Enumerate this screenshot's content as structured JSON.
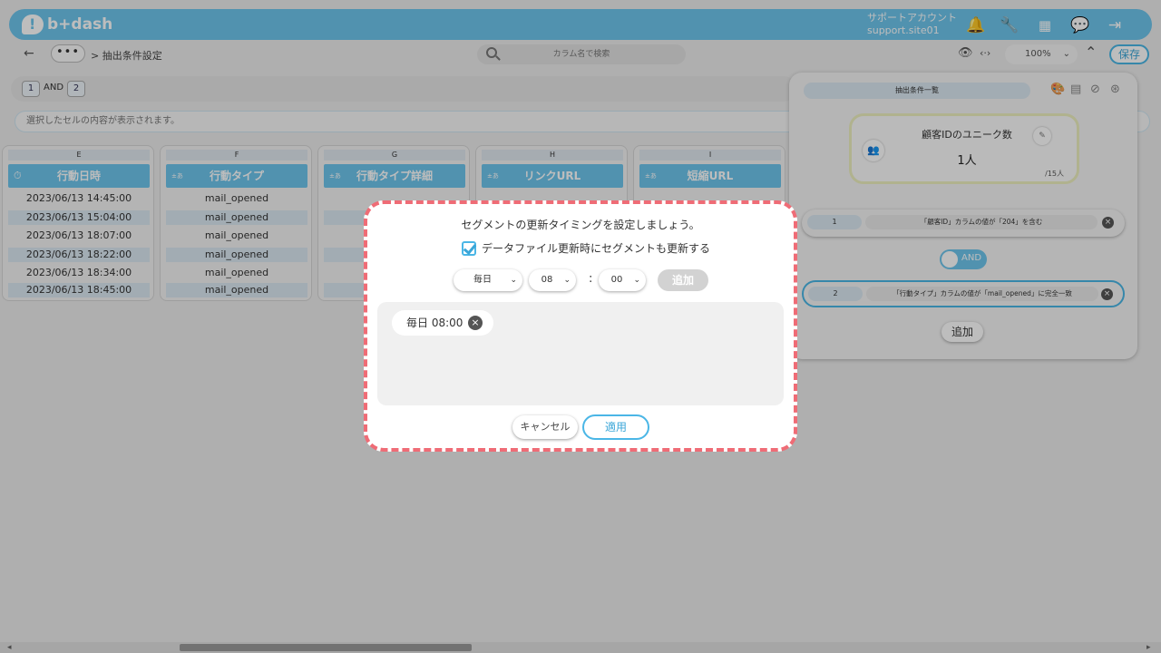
{
  "header": {
    "logo_text": "b+dash",
    "account_name": "サポートアカウント",
    "account_site": "support.site01"
  },
  "toolbar": {
    "more_label": "•••",
    "breadcrumb": "> 抽出条件設定",
    "search_placeholder": "カラム名で検索",
    "zoom_value": "100%",
    "save_label": "保存"
  },
  "conditions": {
    "tab1": "1",
    "and_label": "AND",
    "tab2": "2",
    "cell_info_placeholder": "選択したセルの内容が表示されます。"
  },
  "table": {
    "columns": [
      {
        "letter": "E",
        "type_label": "",
        "header": "行動日時",
        "cells": [
          "2023/06/13 14:45:00",
          "2023/06/13 15:04:00",
          "2023/06/13 18:07:00",
          "2023/06/13 18:22:00",
          "2023/06/13 18:34:00",
          "2023/06/13 18:45:00"
        ]
      },
      {
        "letter": "F",
        "type_label": "±あ",
        "header": "行動タイプ",
        "cells": [
          "mail_opened",
          "mail_opened",
          "mail_opened",
          "mail_opened",
          "mail_opened",
          "mail_opened"
        ]
      },
      {
        "letter": "G",
        "type_label": "±あ",
        "header": "行動タイプ詳細",
        "cells": [
          "",
          "",
          "",
          "",
          "",
          ""
        ]
      },
      {
        "letter": "H",
        "type_label": "±あ",
        "header": "リンクURL",
        "cells": [
          "",
          "",
          "",
          "",
          "",
          ""
        ]
      },
      {
        "letter": "I",
        "type_label": "±あ",
        "header": "短縮URL",
        "cells": [
          "",
          "",
          "",
          "",
          "",
          ""
        ]
      }
    ]
  },
  "right_panel": {
    "tab_label": "抽出条件一覧",
    "kpi": {
      "title": "顧客IDのユニーク数",
      "value": "1人",
      "total": "/15人"
    },
    "rules": [
      {
        "num": "1",
        "text": "「顧客ID」カラムの値が「204」を含む"
      },
      {
        "num": "2",
        "text": "「行動タイプ」カラムの値が「mail_opened」に完全一致"
      }
    ],
    "and_toggle_label": "AND",
    "add_label": "追加"
  },
  "modal": {
    "title": "セグメントの更新タイミングを設定しましょう。",
    "checkbox_label": "データファイル更新時にセグメントも更新する",
    "checkbox_checked": true,
    "frequency": "毎日",
    "hour": "08",
    "colon": ":",
    "minute": "00",
    "add_label": "追加",
    "schedules": [
      "毎日 08:00"
    ],
    "cancel_label": "キャンセル",
    "apply_label": "適用"
  },
  "colors": {
    "accent": "#6ec5ec",
    "accent_dark": "#4ab6e6",
    "highlight_dash": "#ef6c76"
  },
  "icons": [
    "bell-icon",
    "wrench-icon",
    "grid-icon",
    "chat-icon",
    "logout-icon",
    "eye-icon",
    "code-icon",
    "chevron-up-icon",
    "search-icon",
    "clock-icon",
    "people-icon",
    "close-icon"
  ]
}
